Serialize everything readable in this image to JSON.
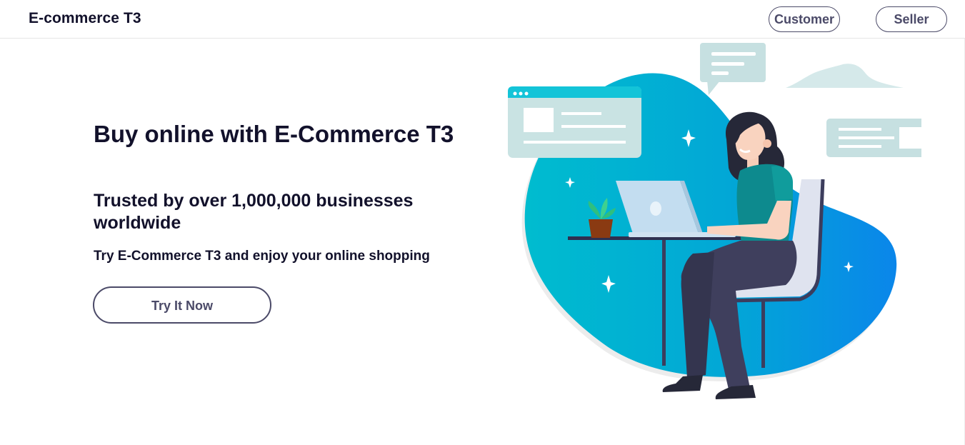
{
  "navbar": {
    "brand": "E-commerce T3",
    "customer_label": "Customer",
    "seller_label": "Seller"
  },
  "hero": {
    "title": "Buy online with E-Commerce T3",
    "subtitle": "Trusted by over 1,000,000 businesses worldwide",
    "description": "Try E-Commerce T3 and enjoy your online shopping",
    "cta_label": "Try It Now"
  },
  "colors": {
    "text_dark": "#12112b",
    "button_border": "#4b4a68",
    "blob_gradient_start": "#00bcd0",
    "blob_gradient_end": "#0a86ea",
    "panel_light": "#c9e3e3"
  },
  "illustration": {
    "name": "woman-working-on-laptop-illustration"
  }
}
